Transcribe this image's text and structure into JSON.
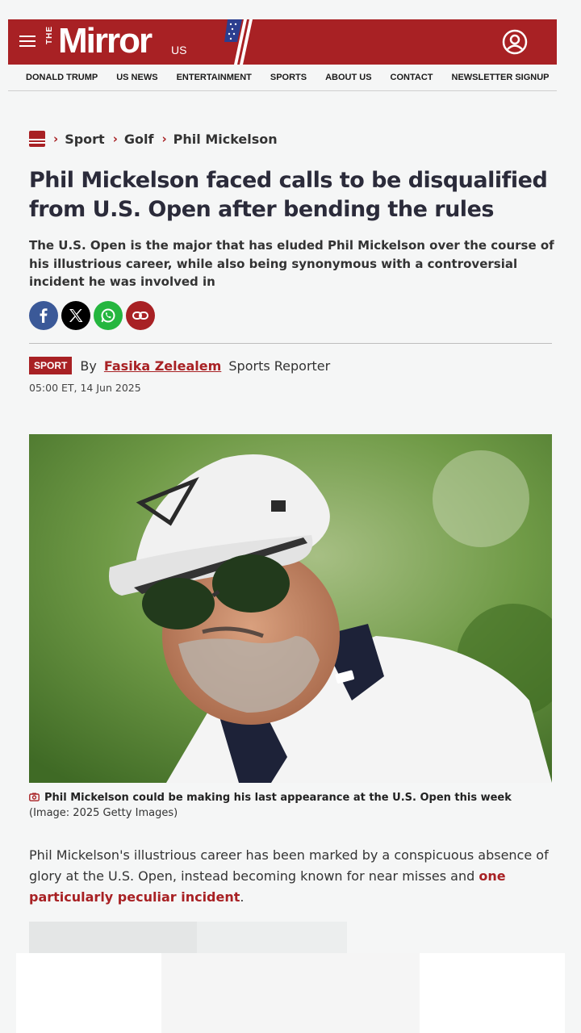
{
  "header": {
    "logo_the": "THE",
    "logo_mirror": "Mirror",
    "logo_us": "US"
  },
  "nav": [
    "DONALD TRUMP",
    "US NEWS",
    "ENTERTAINMENT",
    "SPORTS",
    "ABOUT US",
    "CONTACT",
    "NEWSLETTER SIGNUP"
  ],
  "breadcrumb": [
    "Sport",
    "Golf",
    "Phil Mickelson"
  ],
  "article": {
    "headline": "Phil Mickelson faced calls to be disqualified from U.S. Open after bending the rules",
    "standfirst": "The U.S. Open is the major that has eluded Phil Mickelson over the course of his illustrious career, while also being synonymous with a controversial incident he was involved in",
    "section_tag": "SPORT",
    "by_label": "By",
    "author": "Fasika Zelealem",
    "author_role": "Sports Reporter",
    "dateline": "05:00 ET, 14 Jun 2025",
    "caption_bold": "Phil Mickelson could be making his last appearance at the U.S. Open this week",
    "caption_credit": "(Image: 2025 Getty Images)",
    "para_text": "Phil Mickelson's illustrious career has been marked by a conspicuous absence of glory at the U.S. Open, instead becoming known for near misses and ",
    "para_link": "one particularly peculiar incident",
    "para_end": "."
  },
  "share": [
    "facebook-icon",
    "x-icon",
    "whatsapp-icon",
    "link-icon"
  ],
  "colors": {
    "brand": "#a82124",
    "facebook": "#3b5998",
    "whatsapp": "#25b63f"
  }
}
